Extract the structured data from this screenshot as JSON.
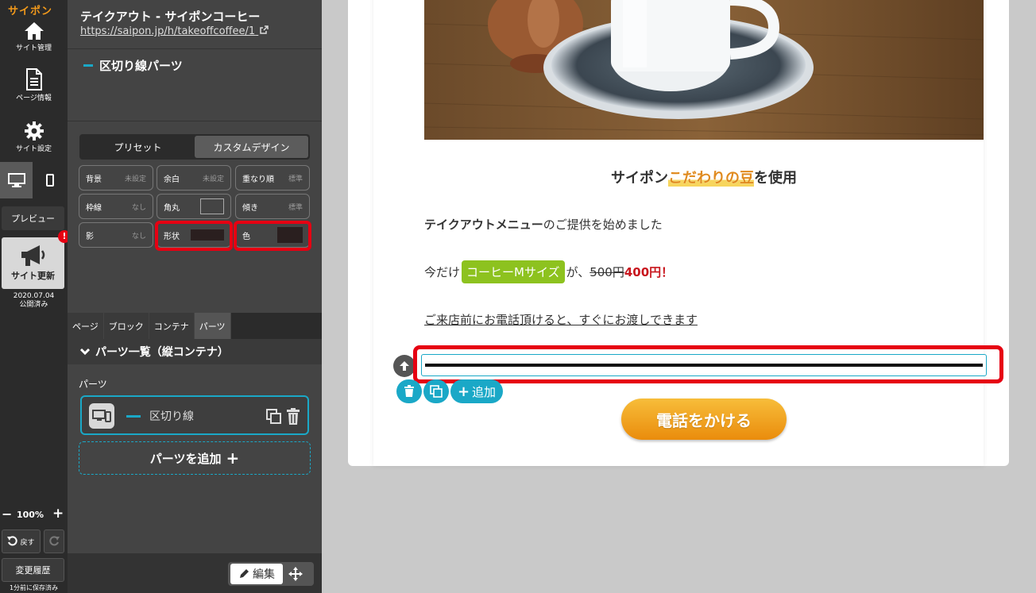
{
  "leftbar": {
    "logo": "サイポン",
    "nav": [
      {
        "label": "サイト管理",
        "icon": "home-icon"
      },
      {
        "label": "ページ情報",
        "icon": "document-icon"
      },
      {
        "label": "サイト設定",
        "icon": "gear-icon"
      }
    ],
    "preview_label": "プレビュー",
    "update_label": "サイト更新",
    "update_badge": "!",
    "update_date": "2020.07.04",
    "update_status": "公開済み",
    "zoom": "100%",
    "undo_label": "戻す",
    "history_label": "変更履歴",
    "saved_note": "1分前に保存済み"
  },
  "panel": {
    "site_title": "テイクアウト - サイポンコーヒー",
    "site_url": "https://saipon.jp/h/takeoffcoffee/1",
    "part_heading": "区切り線パーツ",
    "design_tabs": [
      "プリセット",
      "カスタムデザイン"
    ],
    "design_tab_active": 1,
    "props": [
      {
        "label": "背景",
        "value": "未設定"
      },
      {
        "label": "余白",
        "value": "未設定"
      },
      {
        "label": "重なり順",
        "value": "標準"
      },
      {
        "label": "枠線",
        "value": "なし"
      },
      {
        "label": "角丸",
        "value": ""
      },
      {
        "label": "傾き",
        "value": "標準"
      },
      {
        "label": "影",
        "value": "なし"
      },
      {
        "label": "形状",
        "value": ""
      },
      {
        "label": "色",
        "value": ""
      }
    ],
    "swatch_color": "#2a1f1f",
    "tabs": [
      "ページ",
      "ブロック",
      "コンテナ",
      "パーツ"
    ],
    "tab_active": 3,
    "list_heading": "パーツ一覧（縦コンテナ）",
    "parts_label": "パーツ",
    "part_item": "区切り線",
    "add_part": "パーツを追加",
    "edit_label": "編集"
  },
  "preview": {
    "heading_pre": "サイポン",
    "heading_hl": "こだわりの豆",
    "heading_post": "を使用",
    "p1_bold": "テイクアウトメニュー",
    "p1_rest": "のご提供を始めました",
    "p2_pre": "今だけ",
    "p2_btn": "コーヒーMサイズ",
    "p2_mid": "が、",
    "p2_old": "500円",
    "p2_new": "400円！",
    "p3": "ご来店前にお電話頂けると、すぐにお渡しできます",
    "add_label": "追加",
    "call_button": "電話をかける"
  },
  "colors": {
    "accent": "#1aa8c7",
    "highlight": "#e60012",
    "orange": "#e08a1e",
    "green": "#8dc21f"
  }
}
